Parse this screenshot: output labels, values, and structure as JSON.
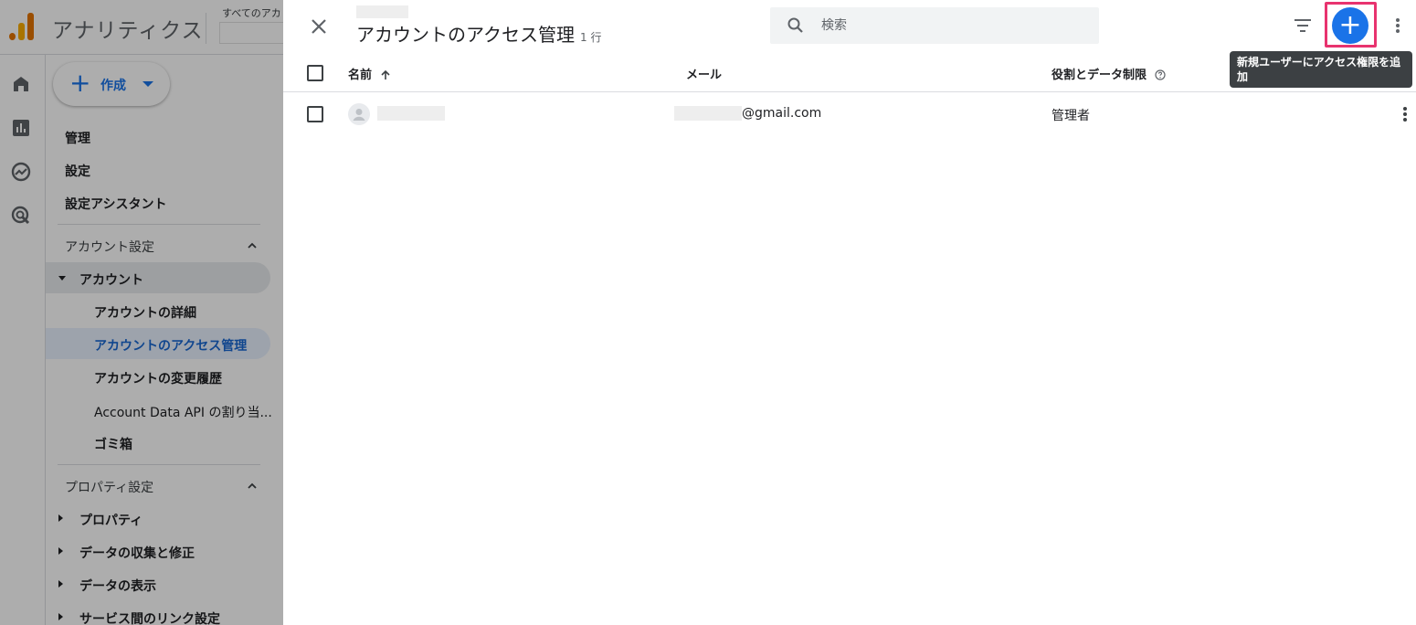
{
  "app": {
    "title": "アナリティクス",
    "account_crumb": "すべてのアカ"
  },
  "rail": {
    "icons": [
      "home-icon",
      "reports-icon",
      "explore-icon",
      "advertising-icon"
    ]
  },
  "nav": {
    "create_label": "作成",
    "items": {
      "admin": "管理",
      "settings": "設定",
      "setup_assistant": "設定アシスタント"
    },
    "account_section": {
      "label": "アカウント設定",
      "group_label": "アカウント",
      "sub_items": [
        "アカウントの詳細",
        "アカウントのアクセス管理",
        "アカウントの変更履歴",
        "Account Data API の割り当...",
        "ゴミ箱"
      ]
    },
    "property_section": {
      "label": "プロパティ設定",
      "items": [
        "プロパティ",
        "データの収集と修正",
        "データの表示",
        "サービス間のリンク設定"
      ]
    }
  },
  "panel": {
    "title": "アカウントのアクセス管理",
    "row_count": "1 行",
    "search_placeholder": "検索",
    "tooltip": "新規ユーザーにアクセス権限を追加",
    "add_label": "+",
    "columns": {
      "name": "名前",
      "email": "メール",
      "role": "役割とデータ制限"
    },
    "rows": [
      {
        "email_suffix": "@gmail.com",
        "role": "管理者"
      }
    ]
  },
  "colors": {
    "accent": "#1a73e8",
    "highlight": "#e8336f",
    "tooltip_bg": "#3c4043",
    "active_nav_bg": "#e8f0fe",
    "active_nav_text": "#1967d2"
  }
}
